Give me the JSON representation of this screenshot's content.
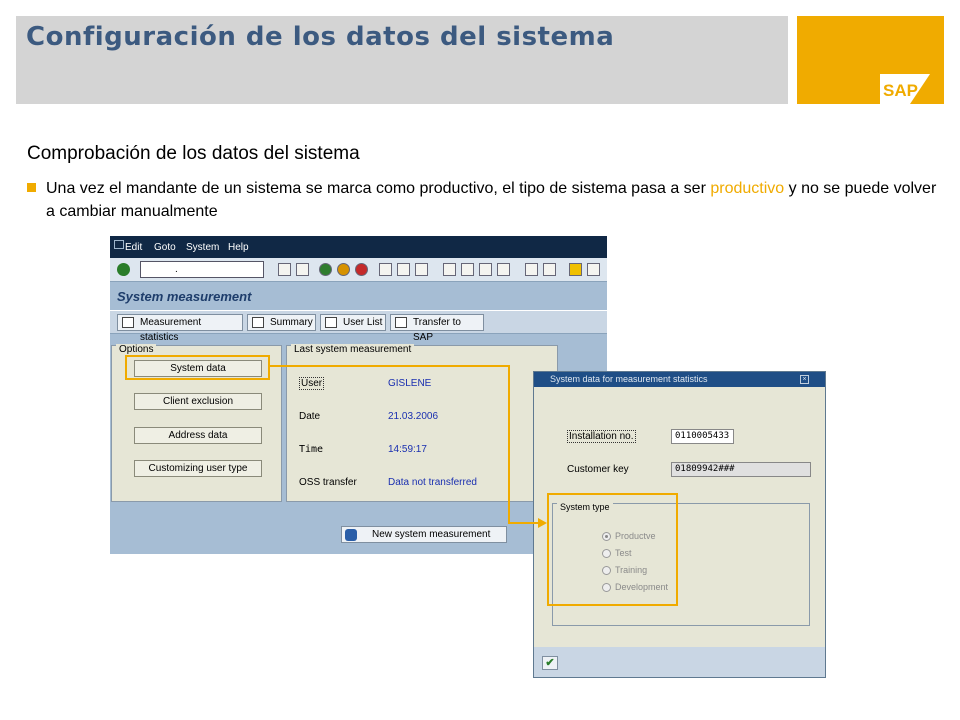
{
  "slide": {
    "title": "Configuración de los datos del sistema",
    "subtitle": "Comprobación de los datos del sistema",
    "bullet_part1": "Una vez el mandante de un sistema se marca como productivo, el tipo de sistema pasa a ser ",
    "bullet_highlight": "productivo",
    "bullet_part2": " y no se puede volver a cambiar manualmente",
    "logo_text": "SAP",
    "accent_color": "#f0ab00"
  },
  "sap_window": {
    "menu": [
      "Edit",
      "Goto",
      "System",
      "Help"
    ],
    "command_field_value": ".",
    "transaction_title": "System measurement",
    "app_toolbar": [
      "Measurement statistics",
      "Summary",
      "User List",
      "Transfer to SAP"
    ],
    "options_tab": "Options",
    "option_buttons": [
      "System data",
      "Client exclusion",
      "Address data",
      "Customizing user type"
    ],
    "last_measurement_tab": "Last system measurement",
    "fields": [
      {
        "label": "User",
        "value": "GISLENE"
      },
      {
        "label": "Date",
        "value": "21.03.2006"
      },
      {
        "label": "Time",
        "value": "14:59:17"
      },
      {
        "label": "OSS transfer",
        "value": "Data not transferred"
      }
    ],
    "new_measurement_button": "New system measurement"
  },
  "dialog": {
    "title": "System data for measurement statistics",
    "close_glyph": "×",
    "installation_label": "Installation no.",
    "installation_value": "0110005433",
    "customer_key_label": "Customer key",
    "customer_key_value": "01809942###",
    "system_type_tab": "System type",
    "radios": [
      "Productve",
      "Test",
      "Training",
      "Development"
    ],
    "selected_radio": "Productve",
    "confirm_glyph": "✔"
  }
}
